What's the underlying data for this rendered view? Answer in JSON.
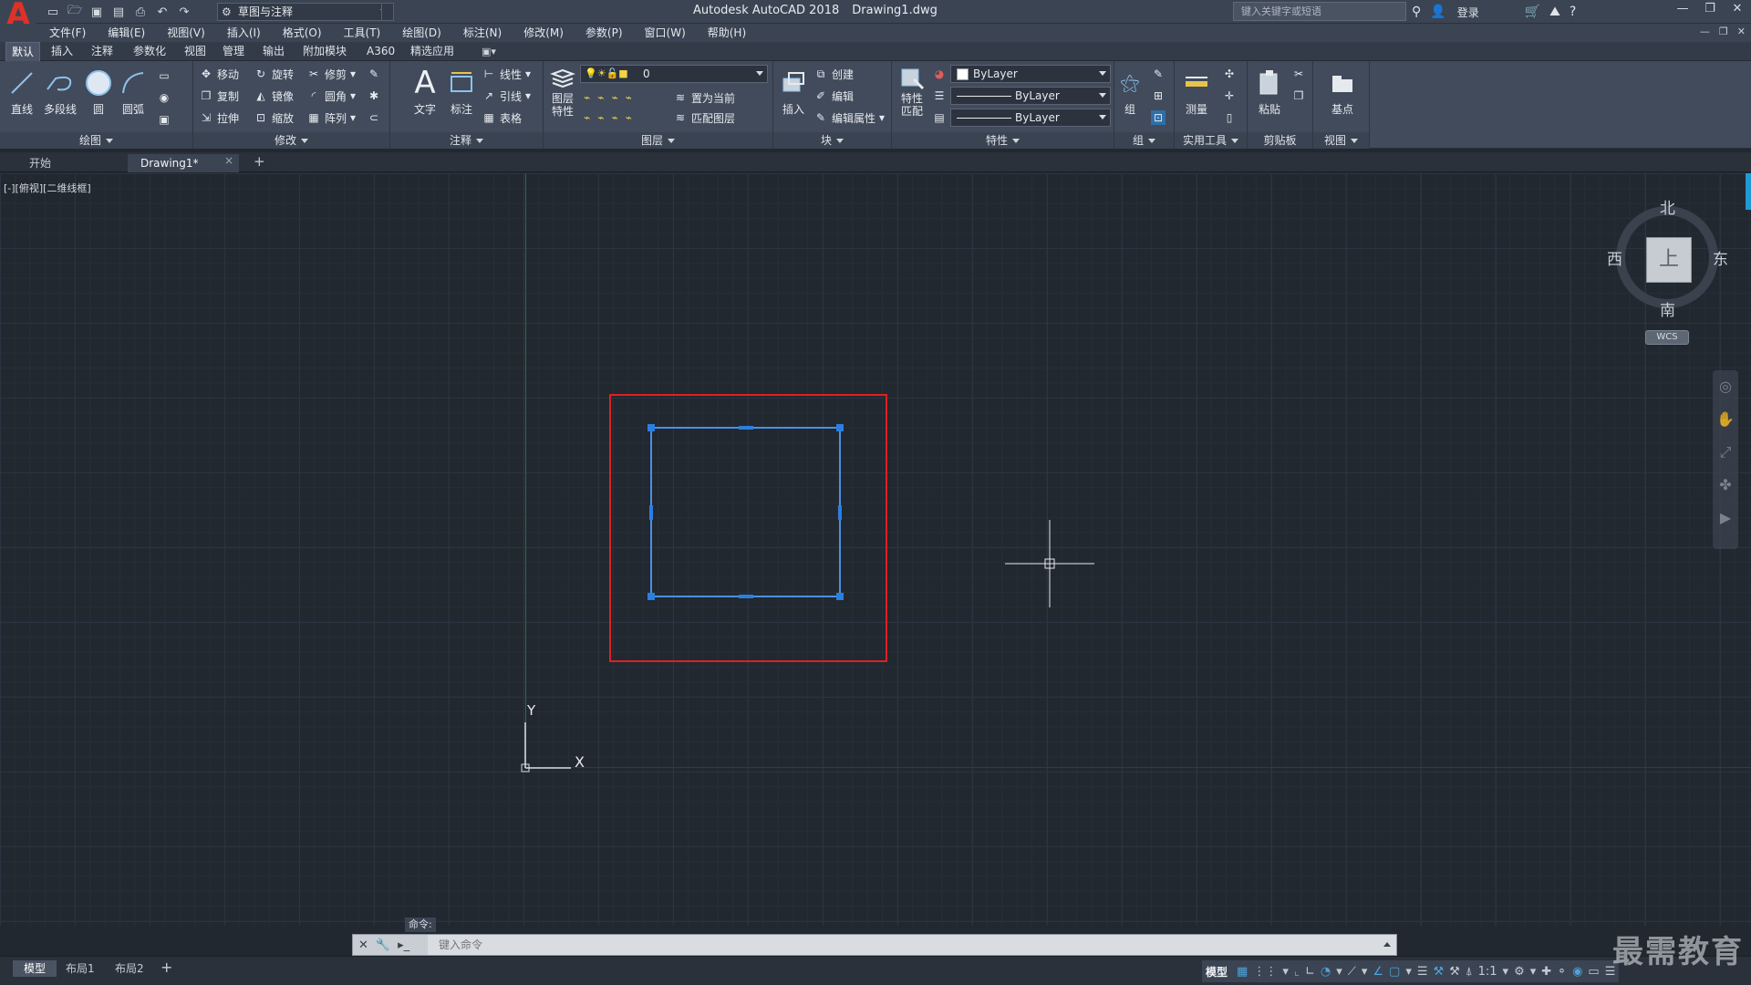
{
  "app": {
    "logo": "A",
    "window_title": "Autodesk AutoCAD 2018",
    "file_name": "Drawing1.dwg",
    "workspace": "草图与注释",
    "search_placeholder": "键入关键字或短语",
    "login": "登录"
  },
  "menu": [
    "文件(F)",
    "编辑(E)",
    "视图(V)",
    "插入(I)",
    "格式(O)",
    "工具(T)",
    "绘图(D)",
    "标注(N)",
    "修改(M)",
    "参数(P)",
    "窗口(W)",
    "帮助(H)"
  ],
  "ribbon_tabs": [
    "默认",
    "插入",
    "注释",
    "参数化",
    "视图",
    "管理",
    "输出",
    "附加模块",
    "A360",
    "精选应用"
  ],
  "ribbon": {
    "draw": {
      "title": "绘图",
      "line": "直线",
      "polyline": "多段线",
      "circle": "圆",
      "arc": "圆弧"
    },
    "modify": {
      "title": "修改",
      "move": "移动",
      "rotate": "旋转",
      "trim": "修剪",
      "copy": "复制",
      "mirror": "镜像",
      "fillet": "圆角",
      "stretch": "拉伸",
      "scale": "缩放",
      "array": "阵列"
    },
    "annotate": {
      "title": "注释",
      "text": "文字",
      "dimension": "标注",
      "linear": "线性",
      "leader": "引线",
      "table": "表格"
    },
    "layers": {
      "title": "图层",
      "props": "图层\n特性",
      "current_layer": "0",
      "set_current": "置为当前",
      "match_layer": "匹配图层"
    },
    "block": {
      "title": "块",
      "insert": "插入",
      "create": "创建",
      "edit": "编辑",
      "edit_attr": "编辑属性"
    },
    "properties": {
      "title": "特性",
      "match": "特性\n匹配",
      "color": "ByLayer",
      "linetype": "ByLayer",
      "lineweight": "ByLayer"
    },
    "groups": {
      "title": "组",
      "group": "组"
    },
    "utilities": {
      "title": "实用工具",
      "measure": "测量"
    },
    "clipboard": {
      "title": "剪贴板",
      "paste": "粘贴"
    },
    "view": {
      "title": "视图",
      "base": "基点"
    }
  },
  "doc_tabs": {
    "start": "开始",
    "drawing": "Drawing1*",
    "close": "×",
    "add": "+"
  },
  "canvas": {
    "viewport_label": "[-][俯视][二维线框]",
    "y_label": "Y",
    "x_label": "X",
    "compass": {
      "north": "北",
      "south": "南",
      "west": "西",
      "east": "东",
      "top": "上"
    },
    "wcs": "WCS",
    "selection_color": "#4a90e2",
    "highlight_color": "#e02020"
  },
  "command": {
    "label": "命令:",
    "placeholder": "键入命令"
  },
  "status": {
    "layout_tabs": [
      "模型",
      "布局1",
      "布局2"
    ],
    "add": "+",
    "model": "模型",
    "scale": "1:1"
  },
  "watermark": "最需教育"
}
